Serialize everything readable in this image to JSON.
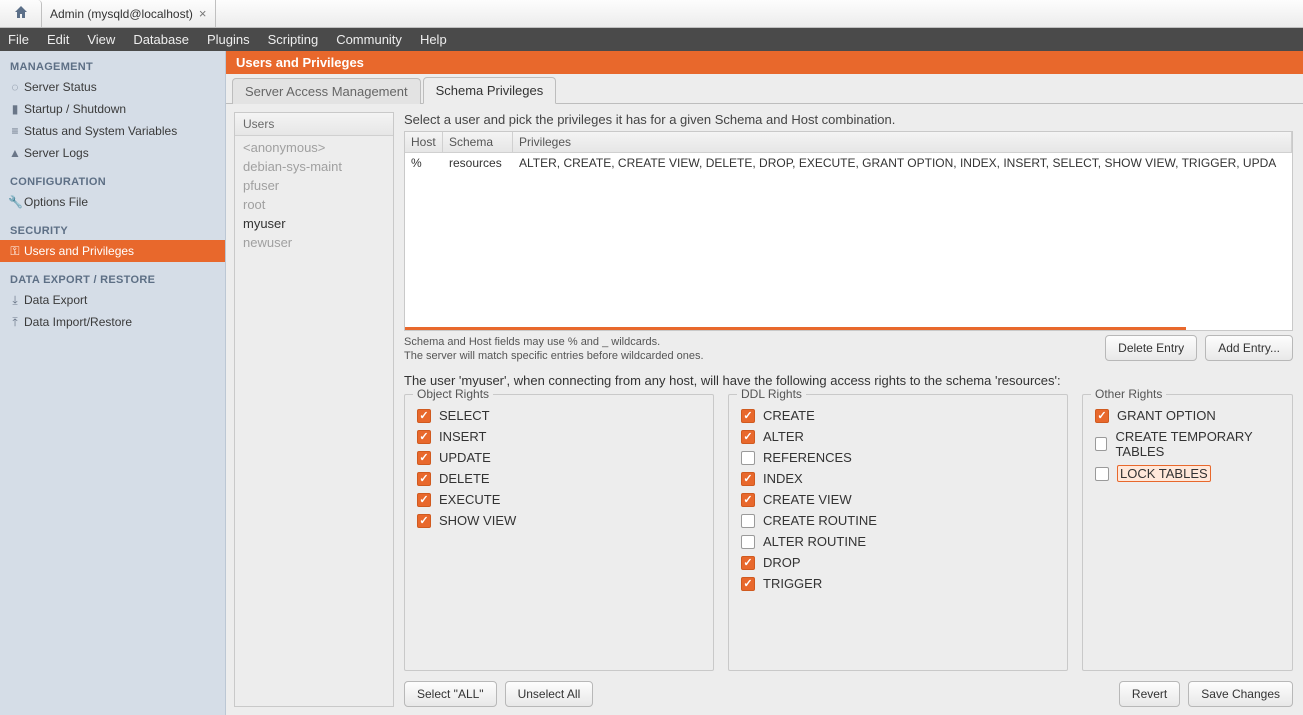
{
  "tab_title": "Admin (mysqld@localhost)",
  "menu": [
    "File",
    "Edit",
    "View",
    "Database",
    "Plugins",
    "Scripting",
    "Community",
    "Help"
  ],
  "sidebar": {
    "management": {
      "heading": "MANAGEMENT",
      "items": [
        "Server Status",
        "Startup / Shutdown",
        "Status and System Variables",
        "Server Logs"
      ]
    },
    "configuration": {
      "heading": "CONFIGURATION",
      "items": [
        "Options File"
      ]
    },
    "security": {
      "heading": "SECURITY",
      "items": [
        "Users and Privileges"
      ]
    },
    "data": {
      "heading": "DATA EXPORT / RESTORE",
      "items": [
        "Data Export",
        "Data Import/Restore"
      ]
    }
  },
  "page_title": "Users and Privileges",
  "tabs": {
    "a": "Server Access Management",
    "b": "Schema Privileges"
  },
  "users_heading": "Users",
  "users": [
    "<anonymous>",
    "debian-sys-maint",
    "pfuser",
    "root",
    "myuser",
    "newuser"
  ],
  "selected_user": "myuser",
  "instruction": "Select a user and pick the privileges it has for a given Schema and Host combination.",
  "grid": {
    "headers": {
      "host": "Host",
      "schema": "Schema",
      "priv": "Privileges"
    },
    "row": {
      "host": "%",
      "schema": "resources",
      "priv": "ALTER, CREATE, CREATE VIEW, DELETE, DROP, EXECUTE, GRANT OPTION, INDEX, INSERT, SELECT, SHOW VIEW, TRIGGER, UPDA"
    }
  },
  "hint1": "Schema and Host fields may use % and _ wildcards.",
  "hint2": "The server will match specific entries before wildcarded ones.",
  "btn_delete": "Delete Entry",
  "btn_add": "Add Entry...",
  "user_desc": "The user 'myuser', when connecting from any host, will have the following access rights to the schema 'resources':",
  "legends": {
    "obj": "Object Rights",
    "ddl": "DDL Rights",
    "other": "Other Rights"
  },
  "object_rights": [
    {
      "label": "SELECT",
      "checked": true
    },
    {
      "label": "INSERT",
      "checked": true
    },
    {
      "label": "UPDATE",
      "checked": true
    },
    {
      "label": "DELETE",
      "checked": true
    },
    {
      "label": "EXECUTE",
      "checked": true
    },
    {
      "label": "SHOW VIEW",
      "checked": true
    }
  ],
  "ddl_rights": [
    {
      "label": "CREATE",
      "checked": true
    },
    {
      "label": "ALTER",
      "checked": true
    },
    {
      "label": "REFERENCES",
      "checked": false
    },
    {
      "label": "INDEX",
      "checked": true
    },
    {
      "label": "CREATE VIEW",
      "checked": true
    },
    {
      "label": "CREATE ROUTINE",
      "checked": false
    },
    {
      "label": "ALTER ROUTINE",
      "checked": false
    },
    {
      "label": "DROP",
      "checked": true
    },
    {
      "label": "TRIGGER",
      "checked": true
    }
  ],
  "other_rights": [
    {
      "label": "GRANT OPTION",
      "checked": true,
      "hl": false
    },
    {
      "label": "CREATE TEMPORARY TABLES",
      "checked": false,
      "hl": false
    },
    {
      "label": "LOCK TABLES",
      "checked": false,
      "hl": true
    }
  ],
  "btn_select_all": "Select \"ALL\"",
  "btn_unselect_all": "Unselect All",
  "btn_revert": "Revert",
  "btn_save": "Save Changes"
}
